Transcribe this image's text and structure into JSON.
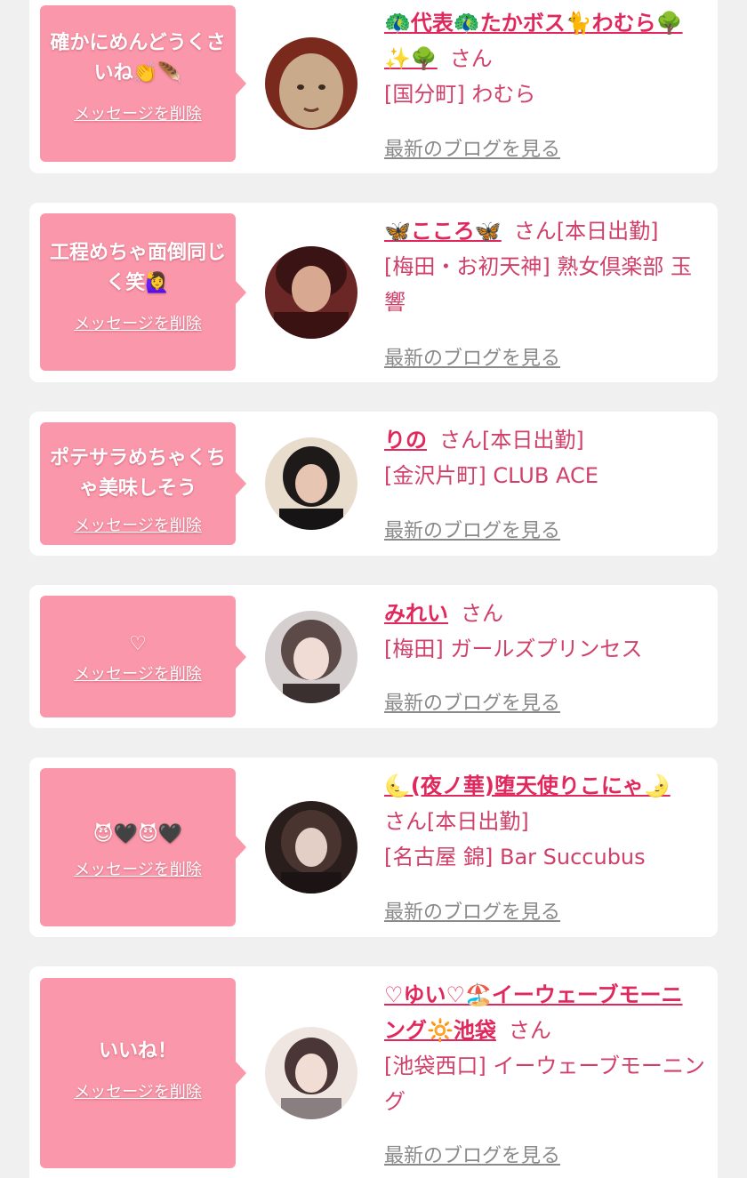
{
  "common": {
    "delete_label": "メッセージを削除",
    "blog_label": "最新のブログを見る",
    "san": "さん",
    "on_duty": "[本日出勤]"
  },
  "entries": [
    {
      "message": "確かにめんどうくさいね👏🪶",
      "name": "🦚代表🦚たかボス🐈わむら🌳✨🌳",
      "name_line1": "🦚代表🦚たかボス🐈わむら🌳",
      "name_line2": "✨🌳",
      "duty": "",
      "shop": "[国分町] わむら",
      "avatar": "bald-face-avatar"
    },
    {
      "message": "工程めちゃ面倒同じく笑🙋‍♀️",
      "name": "🦋こころ🦋",
      "duty": "[本日出勤]",
      "shop": "[梅田・お初天神] 熟女倶楽部 玉響",
      "avatar": "woman-avatar"
    },
    {
      "message": "ポテサラめちゃくちゃ美味しそう",
      "name": "りの",
      "duty": "[本日出勤]",
      "shop": "[金沢片町] CLUB ACE",
      "avatar": "woman-avatar"
    },
    {
      "message": "♡",
      "name": "みれい",
      "duty": "",
      "shop": "[梅田] ガールズプリンセス",
      "avatar": "woman-avatar"
    },
    {
      "message": "😈🖤😈🖤",
      "name": "🌜(夜ノ華)堕天使りこにゃ🌛",
      "duty": "[本日出勤]",
      "shop": "[名古屋 錦] Bar Succubus",
      "avatar": "woman-avatar"
    },
    {
      "message": "いいね！",
      "name": "♡ゆい♡🏖️イーウェーブモーニング🔆池袋",
      "name_line1": "♡ゆい♡🏖️イーウェーブモーニ",
      "name_line2": "ング🔆池袋",
      "duty": "",
      "shop": "[池袋西口] イーウェーブモーニング",
      "avatar": "woman-avatar"
    }
  ],
  "colors": {
    "bubble": "#fb97aa",
    "name": "#e0285c",
    "shop": "#d0406a",
    "blog": "#8a8a8a",
    "background": "#f0f0f0"
  }
}
